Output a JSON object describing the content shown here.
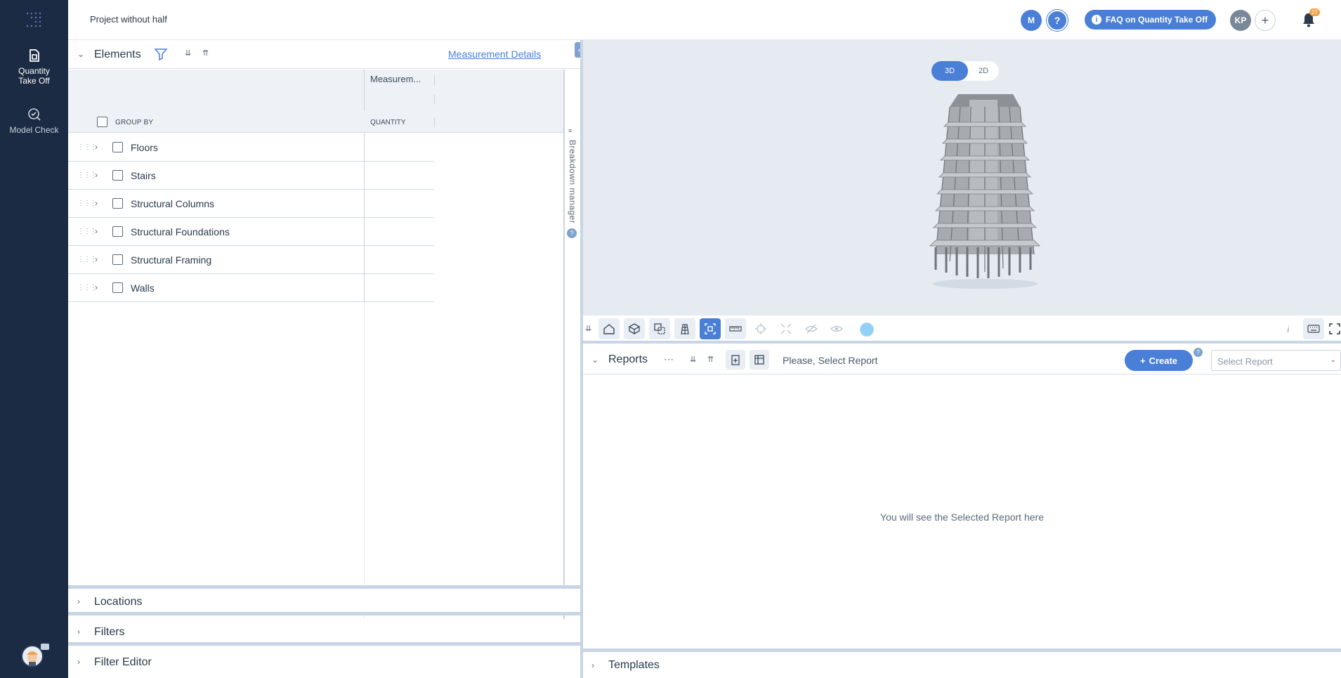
{
  "app": {
    "project_name": "Project without half"
  },
  "rail": {
    "items": [
      {
        "label_line1": "Quantity",
        "label_line2": "Take Off",
        "icon": "quantity-takeoff-icon"
      },
      {
        "label_line1": "Model Check",
        "label_line2": "",
        "icon": "model-check-icon"
      }
    ]
  },
  "topbar": {
    "user_initial": "M",
    "help_icon": "?",
    "faq_label": "FAQ on Quantity Take Off",
    "account_initials": "KP",
    "add_label": "+",
    "notification_count": "27"
  },
  "elements": {
    "title": "Elements",
    "measurement_details_link": "Measurement Details",
    "column_measurement": "Measurem...",
    "group_by_label": "GROUP BY",
    "quantity_label": "QUANTITY",
    "rows": [
      {
        "label": "Floors"
      },
      {
        "label": "Stairs"
      },
      {
        "label": "Structural Columns"
      },
      {
        "label": "Structural Foundations"
      },
      {
        "label": "Structural Framing"
      },
      {
        "label": "Walls"
      }
    ],
    "breakdown_label": "Breakdown manager"
  },
  "accordions": {
    "locations": "Locations",
    "filters": "Filters",
    "filter_editor": "Filter Editor",
    "templates": "Templates"
  },
  "viewer": {
    "mode_3d": "3D",
    "mode_2d": "2D",
    "active_mode": "3D",
    "highlight_color": "#8fd1f7"
  },
  "reports": {
    "title": "Reports",
    "placeholder_text": "Please, Select Report",
    "create_label": "Create",
    "select_placeholder": "Select Report",
    "empty_message": "You will see the Selected Report here"
  },
  "colors": {
    "sidebar": "#1c2b44",
    "accent": "#4a7fd8",
    "panel_border": "#c7d5e4"
  }
}
